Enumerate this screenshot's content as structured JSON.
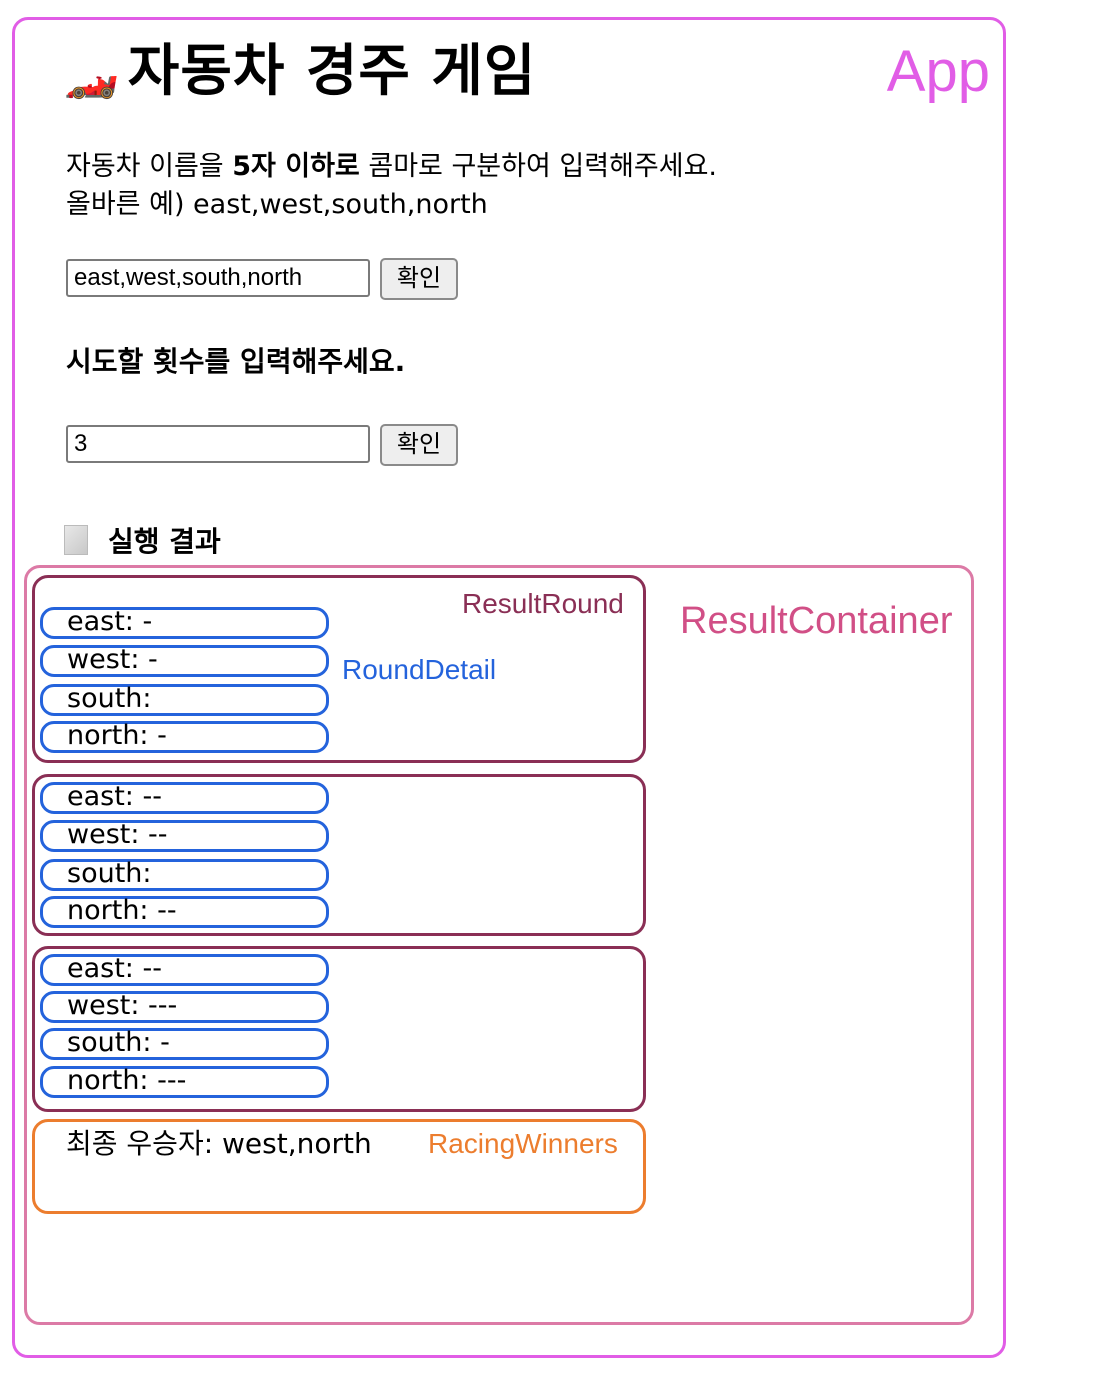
{
  "app": {
    "label": "App",
    "title_icon": "🏎️",
    "title": "자동차 경주 게임"
  },
  "names_section": {
    "desc_prefix": "자동차 이름을 ",
    "desc_bold": "5자 이하로",
    "desc_suffix": " 콤마로 구분하여 입력해주세요.",
    "example": "올바른 예) east,west,south,north",
    "input_value": "east,west,south,north",
    "confirm_label": "확인"
  },
  "count_section": {
    "label": "시도할 횟수를 입력해주세요.",
    "input_value": "3",
    "confirm_label": "확인"
  },
  "result": {
    "title": "실행 결과",
    "container_label": "ResultContainer",
    "round_label": "ResultRound",
    "detail_label": "RoundDetail",
    "rounds": [
      [
        "east: -",
        "west: -",
        "south:",
        "north: -"
      ],
      [
        "east: --",
        "west: --",
        "south:",
        "north: --"
      ],
      [
        "east: --",
        "west: ---",
        "south: -",
        "north: ---"
      ]
    ],
    "winners_text": "최종 우승자: west,north",
    "winners_label": "RacingWinners"
  },
  "colors": {
    "app": "#e15de6",
    "result_container": "#dc7aa6",
    "result_round": "#8a2f55",
    "round_detail": "#2463dc",
    "racing_winners": "#ec7d2e"
  }
}
